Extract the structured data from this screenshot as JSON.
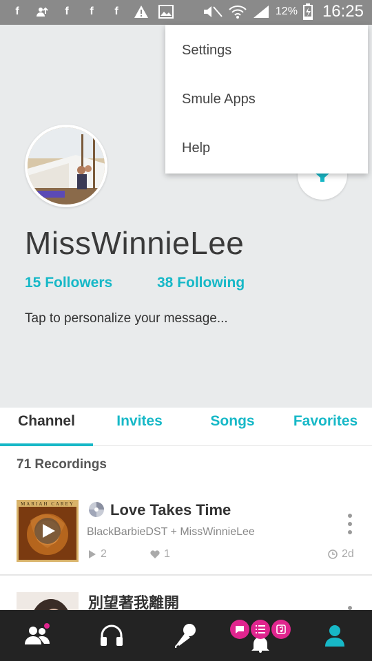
{
  "status_bar": {
    "battery": "12%",
    "time": "16:25"
  },
  "menu": {
    "items": [
      {
        "label": "Settings"
      },
      {
        "label": "Smule Apps"
      },
      {
        "label": "Help"
      }
    ]
  },
  "profile": {
    "username": "MissWinnieLee",
    "followers": "15 Followers",
    "following": "38 Following",
    "message_placeholder": "Tap to personalize your message..."
  },
  "tabs": [
    {
      "label": "Channel"
    },
    {
      "label": "Invites"
    },
    {
      "label": "Songs"
    },
    {
      "label": "Favorites"
    }
  ],
  "recordings": {
    "count_label": "71 Recordings",
    "items": [
      {
        "title": "Love Takes Time",
        "thumb_text": "MARIAH CAREY",
        "performers": "BlackBarbieDST + MissWinnieLee",
        "plays": "2",
        "likes": "1",
        "age": "2d"
      },
      {
        "title": "別望著我離開"
      }
    ]
  },
  "colors": {
    "accent": "#17b8c7",
    "pink": "#e0258e",
    "nav_bg": "#232323",
    "header_bg": "#e9ebec"
  }
}
